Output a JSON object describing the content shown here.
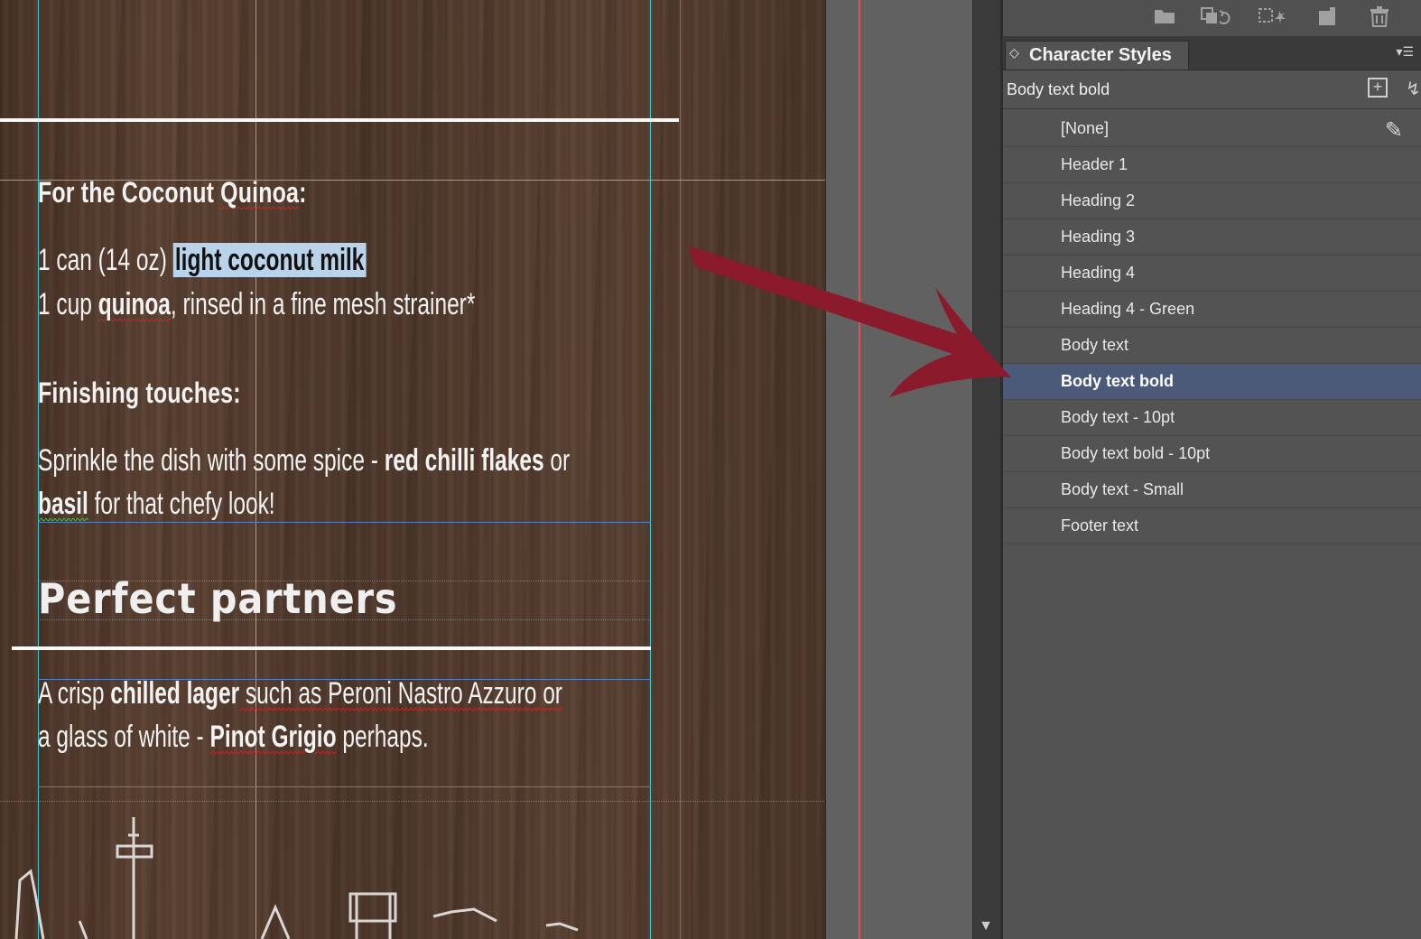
{
  "document": {
    "heading_quinoa": "For the Coconut Quinoa:",
    "ingredient1": {
      "pre": "1 can (14 oz) ",
      "selected": "light coconut milk"
    },
    "ingredient2": {
      "pre": "1 cup ",
      "bold": "quinoa",
      "post": ", rinsed in a fine mesh strainer*"
    },
    "heading_finishing": "Finishing touches:",
    "finish_line1": {
      "pre": "Sprinkle the dish with some spice - ",
      "bold": "red chilli flakes",
      "post": " or"
    },
    "finish_line2": {
      "bold": "basil",
      "post": " for that chefy look!"
    },
    "partners_heading": "Perfect partners",
    "partners_line1": {
      "pre": "A crisp ",
      "bold": "chilled lager",
      "post": " such as Peroni Nastro Azzuro or"
    },
    "partners_line2": {
      "pre": "a glass of white - ",
      "bold": "Pinot Grigio",
      "post": " perhaps."
    }
  },
  "panel": {
    "title": "Character Styles",
    "current_style": "Body text bold",
    "styles": [
      "[None]",
      "Header 1",
      "Heading 2",
      "Heading 3",
      "Heading 4",
      "Heading 4 - Green",
      "Body text",
      "Body text bold",
      "Body text - 10pt",
      "Body text bold - 10pt",
      "Body text - Small",
      "Footer text"
    ],
    "selected_style": "Body text bold",
    "toolbar_icons": [
      "folder-icon",
      "load-styles-icon",
      "clear-overrides-icon",
      "new-style-icon",
      "trash-icon"
    ]
  },
  "colors": {
    "arrow": "#8a1a2c",
    "selection_highlight": "#4a5a78",
    "text_selection": "#b9d3ea"
  }
}
